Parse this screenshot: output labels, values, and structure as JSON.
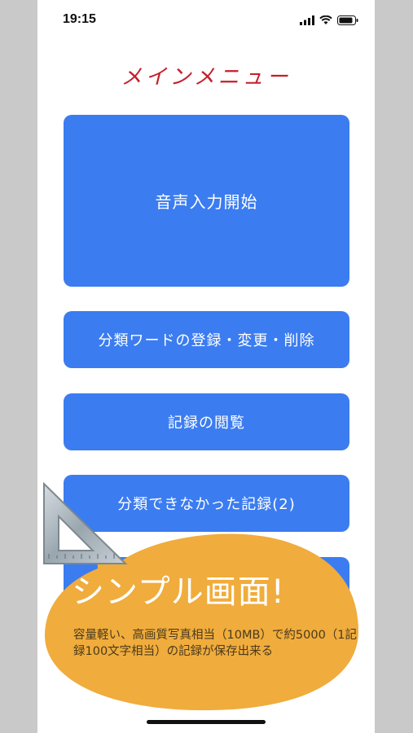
{
  "status_bar": {
    "time": "19:15",
    "icons": [
      "cellular-signal-icon",
      "wifi-icon",
      "battery-icon"
    ]
  },
  "page_title": "メインメニュー",
  "menu": {
    "voice_input_label": "音声入力開始",
    "classification_words_label": "分類ワードの登録・変更・削除",
    "view_records_label": "記録の閲覧",
    "unclassified_records_label": "分類できなかった記録(2)"
  },
  "promo": {
    "title": "シンプル画面!",
    "description": "容量軽い、高画質写真相当（10MB）で約5000（1記録100文字相当）の記録が保存出来る"
  },
  "colors": {
    "title_red": "#c41f2a",
    "button_blue": "#3b7cf0",
    "bubble_orange": "#f0ac3c"
  }
}
